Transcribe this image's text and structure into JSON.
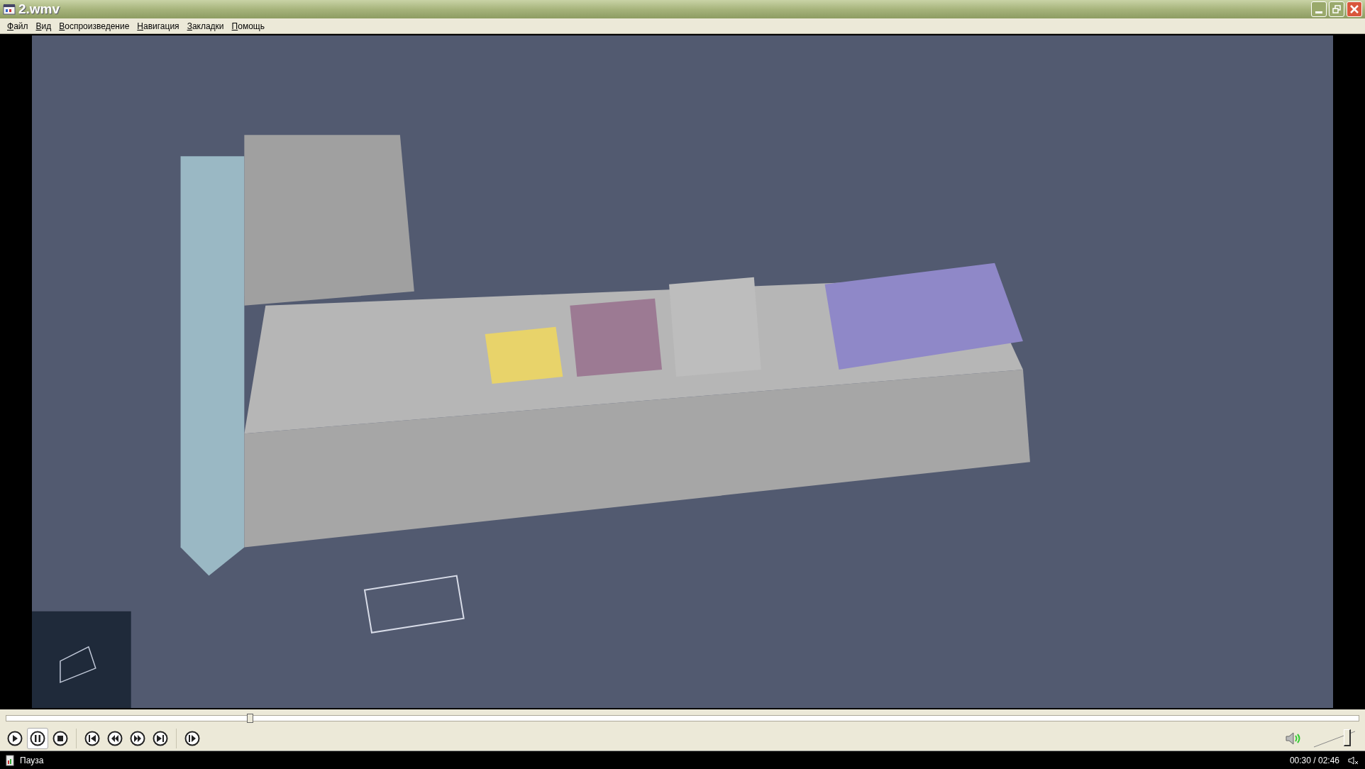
{
  "window": {
    "title": "2.wmv"
  },
  "menu": [
    {
      "label": "Файл",
      "mnemonic": true
    },
    {
      "label": "Вид",
      "mnemonic": true
    },
    {
      "label": "Воспроизведение",
      "mnemonic": true
    },
    {
      "label": "Навигация",
      "mnemonic": true
    },
    {
      "label": "Закладки",
      "mnemonic": true
    },
    {
      "label": "Помощь",
      "mnemonic": true
    }
  ],
  "seek": {
    "level": 0.18
  },
  "controls": [
    {
      "kind": "play",
      "pressed": false
    },
    {
      "kind": "pause",
      "pressed": true
    },
    {
      "kind": "stop",
      "pressed": false
    },
    {
      "kind": "prev",
      "pressed": false
    },
    {
      "kind": "rewind",
      "pressed": false
    },
    {
      "kind": "forward",
      "pressed": false
    },
    {
      "kind": "next",
      "pressed": false
    },
    {
      "kind": "step",
      "pressed": false
    }
  ],
  "volume": {
    "level": 0.85
  },
  "status_bar": {
    "state": "Пауза",
    "time": "00:30 / 02:46"
  }
}
